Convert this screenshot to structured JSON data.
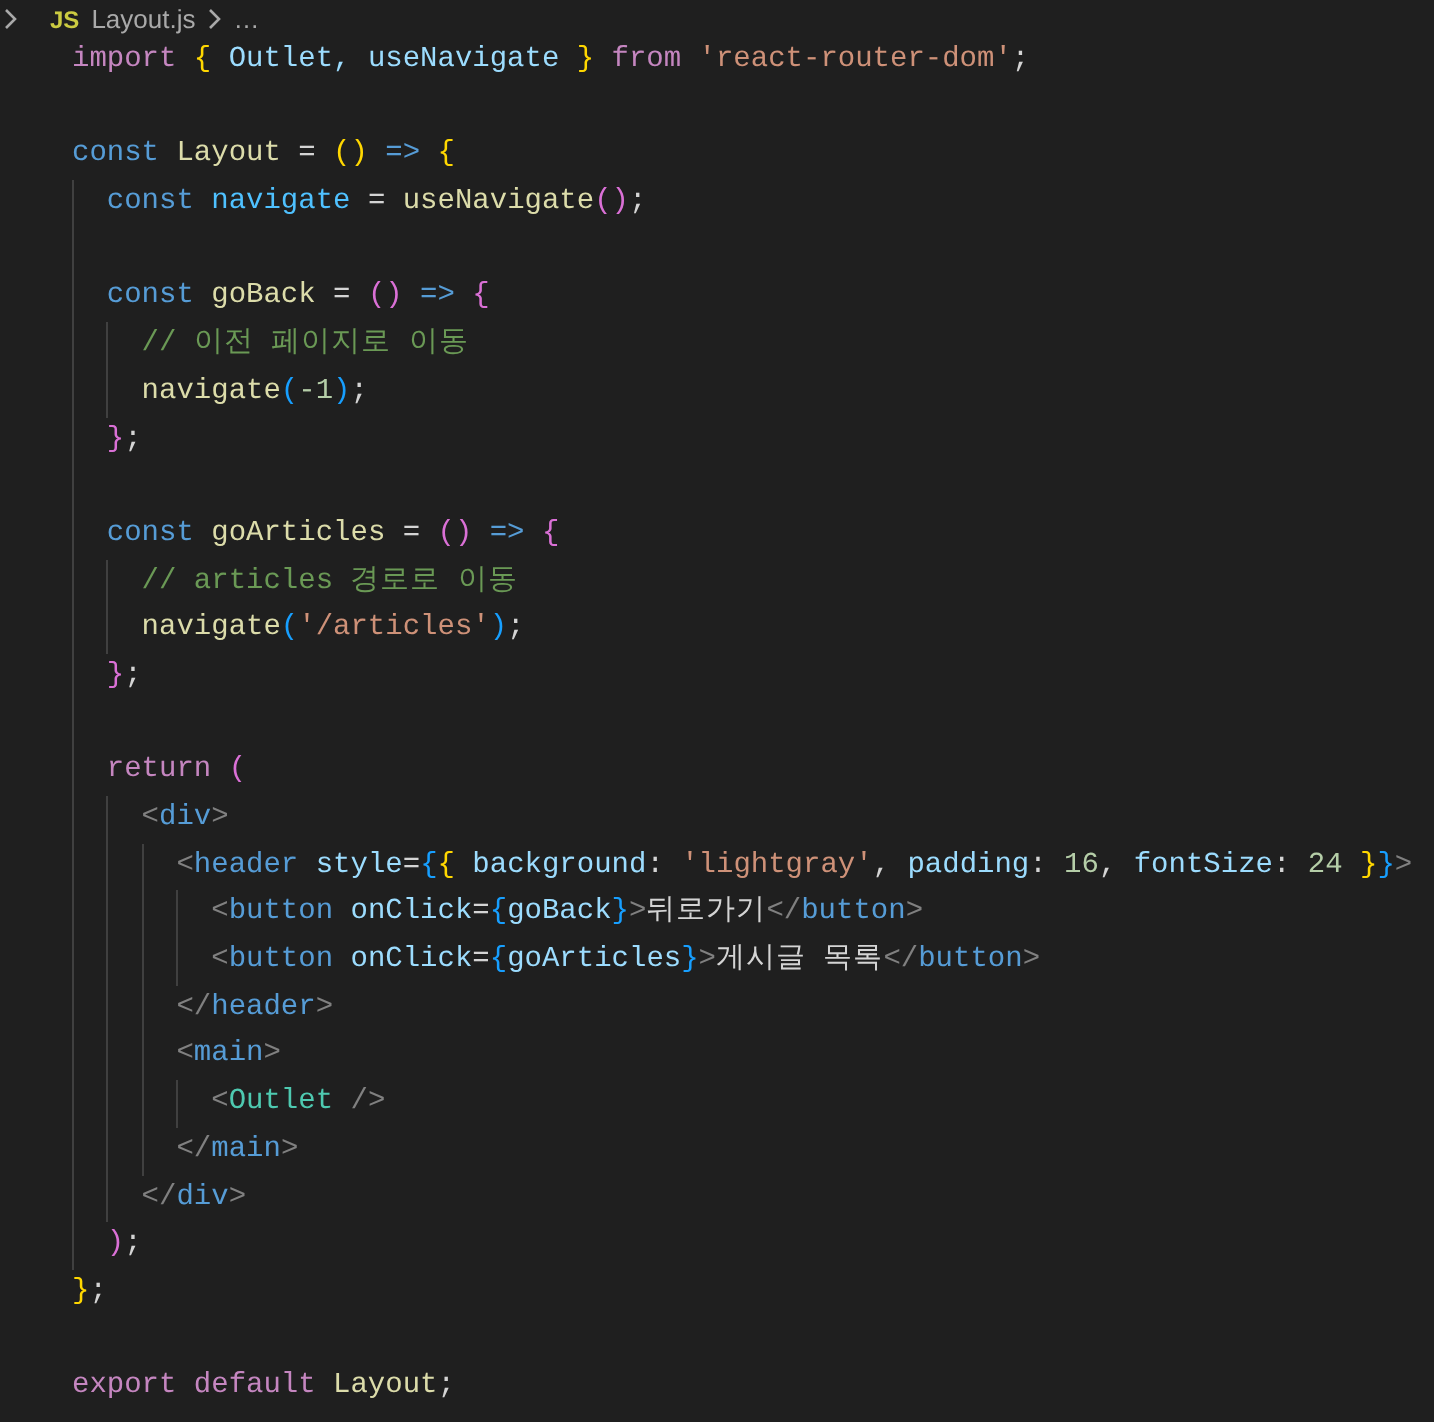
{
  "breadcrumb": {
    "file_badge": "JS",
    "file_name": "Layout.js",
    "more": "…"
  },
  "lines": [
    {
      "kind": "code",
      "tokens": [
        {
          "text": "import ",
          "kind": "keyword"
        },
        {
          "text": "{",
          "kind": "bracket1"
        },
        {
          "text": " Outlet, useNavigate ",
          "kind": "variable"
        },
        {
          "text": "}",
          "kind": "bracket1"
        },
        {
          "text": " from ",
          "kind": "keyword"
        },
        {
          "text": "'react-router-dom'",
          "kind": "string"
        },
        {
          "text": ";",
          "kind": "plain"
        }
      ]
    },
    {
      "kind": "blank"
    },
    {
      "kind": "code",
      "tokens": [
        {
          "text": "const ",
          "kind": "storage"
        },
        {
          "text": "Layout",
          "kind": "function"
        },
        {
          "text": " = ",
          "kind": "plain"
        },
        {
          "text": "()",
          "kind": "bracket1"
        },
        {
          "text": " => ",
          "kind": "storage"
        },
        {
          "text": "{",
          "kind": "bracket1"
        }
      ]
    },
    {
      "kind": "code",
      "tokens": [
        {
          "text": "  const ",
          "kind": "storage"
        },
        {
          "text": "navigate",
          "kind": "constant"
        },
        {
          "text": " = ",
          "kind": "plain"
        },
        {
          "text": "useNavigate",
          "kind": "function"
        },
        {
          "text": "()",
          "kind": "bracket2"
        },
        {
          "text": ";",
          "kind": "plain"
        }
      ]
    },
    {
      "kind": "blank"
    },
    {
      "kind": "code",
      "tokens": [
        {
          "text": "  const ",
          "kind": "storage"
        },
        {
          "text": "goBack",
          "kind": "function"
        },
        {
          "text": " = ",
          "kind": "plain"
        },
        {
          "text": "()",
          "kind": "bracket2"
        },
        {
          "text": " => ",
          "kind": "storage"
        },
        {
          "text": "{",
          "kind": "bracket2"
        }
      ]
    },
    {
      "kind": "code",
      "tokens": [
        {
          "text": "    // 이전 페이지로 이동",
          "kind": "comment"
        }
      ]
    },
    {
      "kind": "code",
      "tokens": [
        {
          "text": "    navigate",
          "kind": "function"
        },
        {
          "text": "(",
          "kind": "bracket3"
        },
        {
          "text": "-1",
          "kind": "number"
        },
        {
          "text": ")",
          "kind": "bracket3"
        },
        {
          "text": ";",
          "kind": "plain"
        }
      ]
    },
    {
      "kind": "code",
      "tokens": [
        {
          "text": "  }",
          "kind": "bracket2"
        },
        {
          "text": ";",
          "kind": "plain"
        }
      ]
    },
    {
      "kind": "blank"
    },
    {
      "kind": "code",
      "tokens": [
        {
          "text": "  const ",
          "kind": "storage"
        },
        {
          "text": "goArticles",
          "kind": "function"
        },
        {
          "text": " = ",
          "kind": "plain"
        },
        {
          "text": "()",
          "kind": "bracket2"
        },
        {
          "text": " => ",
          "kind": "storage"
        },
        {
          "text": "{",
          "kind": "bracket2"
        }
      ]
    },
    {
      "kind": "code",
      "tokens": [
        {
          "text": "    // articles 경로로 이동",
          "kind": "comment"
        }
      ]
    },
    {
      "kind": "code",
      "tokens": [
        {
          "text": "    navigate",
          "kind": "function"
        },
        {
          "text": "(",
          "kind": "bracket3"
        },
        {
          "text": "'/articles'",
          "kind": "string"
        },
        {
          "text": ")",
          "kind": "bracket3"
        },
        {
          "text": ";",
          "kind": "plain"
        }
      ]
    },
    {
      "kind": "code",
      "tokens": [
        {
          "text": "  }",
          "kind": "bracket2"
        },
        {
          "text": ";",
          "kind": "plain"
        }
      ]
    },
    {
      "kind": "blank"
    },
    {
      "kind": "code",
      "tokens": [
        {
          "text": "  return ",
          "kind": "keyword"
        },
        {
          "text": "(",
          "kind": "bracket2"
        }
      ]
    },
    {
      "kind": "code",
      "tokens": [
        {
          "text": "    <",
          "kind": "tagbr"
        },
        {
          "text": "div",
          "kind": "tag"
        },
        {
          "text": ">",
          "kind": "tagbr"
        }
      ]
    },
    {
      "kind": "code",
      "tokens": [
        {
          "text": "      <",
          "kind": "tagbr"
        },
        {
          "text": "header",
          "kind": "tag"
        },
        {
          "text": " style",
          "kind": "variable"
        },
        {
          "text": "=",
          "kind": "plain"
        },
        {
          "text": "{",
          "kind": "bracket3"
        },
        {
          "text": "{",
          "kind": "bracket1"
        },
        {
          "text": " background",
          "kind": "variable"
        },
        {
          "text": ": ",
          "kind": "plain"
        },
        {
          "text": "'lightgray'",
          "kind": "string"
        },
        {
          "text": ", ",
          "kind": "plain"
        },
        {
          "text": "padding",
          "kind": "variable"
        },
        {
          "text": ": ",
          "kind": "plain"
        },
        {
          "text": "16",
          "kind": "number"
        },
        {
          "text": ", ",
          "kind": "plain"
        },
        {
          "text": "fontSize",
          "kind": "variable"
        },
        {
          "text": ": ",
          "kind": "plain"
        },
        {
          "text": "24",
          "kind": "number"
        },
        {
          "text": " }",
          "kind": "bracket1"
        },
        {
          "text": "}",
          "kind": "bracket3"
        },
        {
          "text": ">",
          "kind": "tagbr"
        }
      ]
    },
    {
      "kind": "code",
      "tokens": [
        {
          "text": "        <",
          "kind": "tagbr"
        },
        {
          "text": "button",
          "kind": "tag"
        },
        {
          "text": " onClick",
          "kind": "variable"
        },
        {
          "text": "=",
          "kind": "plain"
        },
        {
          "text": "{",
          "kind": "bracket3"
        },
        {
          "text": "goBack",
          "kind": "variable"
        },
        {
          "text": "}",
          "kind": "bracket3"
        },
        {
          "text": ">",
          "kind": "tagbr"
        },
        {
          "text": "뒤로가기",
          "kind": "plain"
        },
        {
          "text": "</",
          "kind": "tagbr"
        },
        {
          "text": "button",
          "kind": "tag"
        },
        {
          "text": ">",
          "kind": "tagbr"
        }
      ]
    },
    {
      "kind": "code",
      "tokens": [
        {
          "text": "        <",
          "kind": "tagbr"
        },
        {
          "text": "button",
          "kind": "tag"
        },
        {
          "text": " onClick",
          "kind": "variable"
        },
        {
          "text": "=",
          "kind": "plain"
        },
        {
          "text": "{",
          "kind": "bracket3"
        },
        {
          "text": "goArticles",
          "kind": "variable"
        },
        {
          "text": "}",
          "kind": "bracket3"
        },
        {
          "text": ">",
          "kind": "tagbr"
        },
        {
          "text": "게시글 목록",
          "kind": "plain"
        },
        {
          "text": "</",
          "kind": "tagbr"
        },
        {
          "text": "button",
          "kind": "tag"
        },
        {
          "text": ">",
          "kind": "tagbr"
        }
      ]
    },
    {
      "kind": "code",
      "tokens": [
        {
          "text": "      </",
          "kind": "tagbr"
        },
        {
          "text": "header",
          "kind": "tag"
        },
        {
          "text": ">",
          "kind": "tagbr"
        }
      ]
    },
    {
      "kind": "code",
      "tokens": [
        {
          "text": "      <",
          "kind": "tagbr"
        },
        {
          "text": "main",
          "kind": "tag"
        },
        {
          "text": ">",
          "kind": "tagbr"
        }
      ]
    },
    {
      "kind": "code",
      "tokens": [
        {
          "text": "        <",
          "kind": "tagbr"
        },
        {
          "text": "Outlet",
          "kind": "component"
        },
        {
          "text": " />",
          "kind": "tagbr"
        }
      ]
    },
    {
      "kind": "code",
      "tokens": [
        {
          "text": "      </",
          "kind": "tagbr"
        },
        {
          "text": "main",
          "kind": "tag"
        },
        {
          "text": ">",
          "kind": "tagbr"
        }
      ]
    },
    {
      "kind": "code",
      "tokens": [
        {
          "text": "    </",
          "kind": "tagbr"
        },
        {
          "text": "div",
          "kind": "tag"
        },
        {
          "text": ">",
          "kind": "tagbr"
        }
      ]
    },
    {
      "kind": "code",
      "tokens": [
        {
          "text": "  )",
          "kind": "bracket2"
        },
        {
          "text": ";",
          "kind": "plain"
        }
      ]
    },
    {
      "kind": "code",
      "tokens": [
        {
          "text": "}",
          "kind": "bracket1"
        },
        {
          "text": ";",
          "kind": "plain"
        }
      ]
    },
    {
      "kind": "blank"
    },
    {
      "kind": "code",
      "tokens": [
        {
          "text": "export default ",
          "kind": "keyword"
        },
        {
          "text": "Layout",
          "kind": "function"
        },
        {
          "text": ";",
          "kind": "plain"
        }
      ]
    }
  ]
}
